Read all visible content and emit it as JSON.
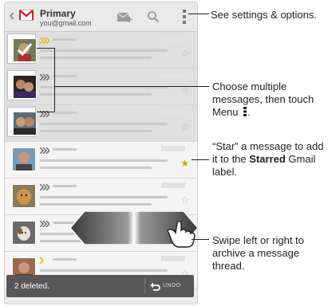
{
  "account": {
    "label": "Primary",
    "email": "you@gmail.com"
  },
  "icons": {
    "compose": "compose-icon",
    "search": "search-icon",
    "menu": "overflow-menu-icon",
    "label_tag": "label-chevron-icon",
    "star": "star-icon"
  },
  "colors": {
    "star_on": "#d6a300",
    "gmail_red": "#c5221f",
    "label_yellow": "#e4c21a"
  },
  "rows": [
    {
      "starred": false,
      "selected": true
    },
    {
      "starred": false,
      "selected": true
    },
    {
      "starred": false,
      "selected": true
    },
    {
      "starred": true,
      "selected": false
    },
    {
      "starred": false,
      "selected": false
    },
    {
      "starred": false,
      "selected": false
    },
    {
      "starred": false,
      "selected": false
    }
  ],
  "star_glyph": "☆",
  "star_glyph_on": "★",
  "snackbar": {
    "message": "2 deleted.",
    "action": "UNDO"
  },
  "callouts": {
    "settings": "See settings & options.",
    "multi_select": "Choose multiple messages, then touch Menu",
    "multi_select_end": ".",
    "star_intro": "“Star” a message to add it to the",
    "star_bold": "Starred",
    "star_end": "Gmail label.",
    "swipe": "Swipe left or right to archive a message thread."
  }
}
